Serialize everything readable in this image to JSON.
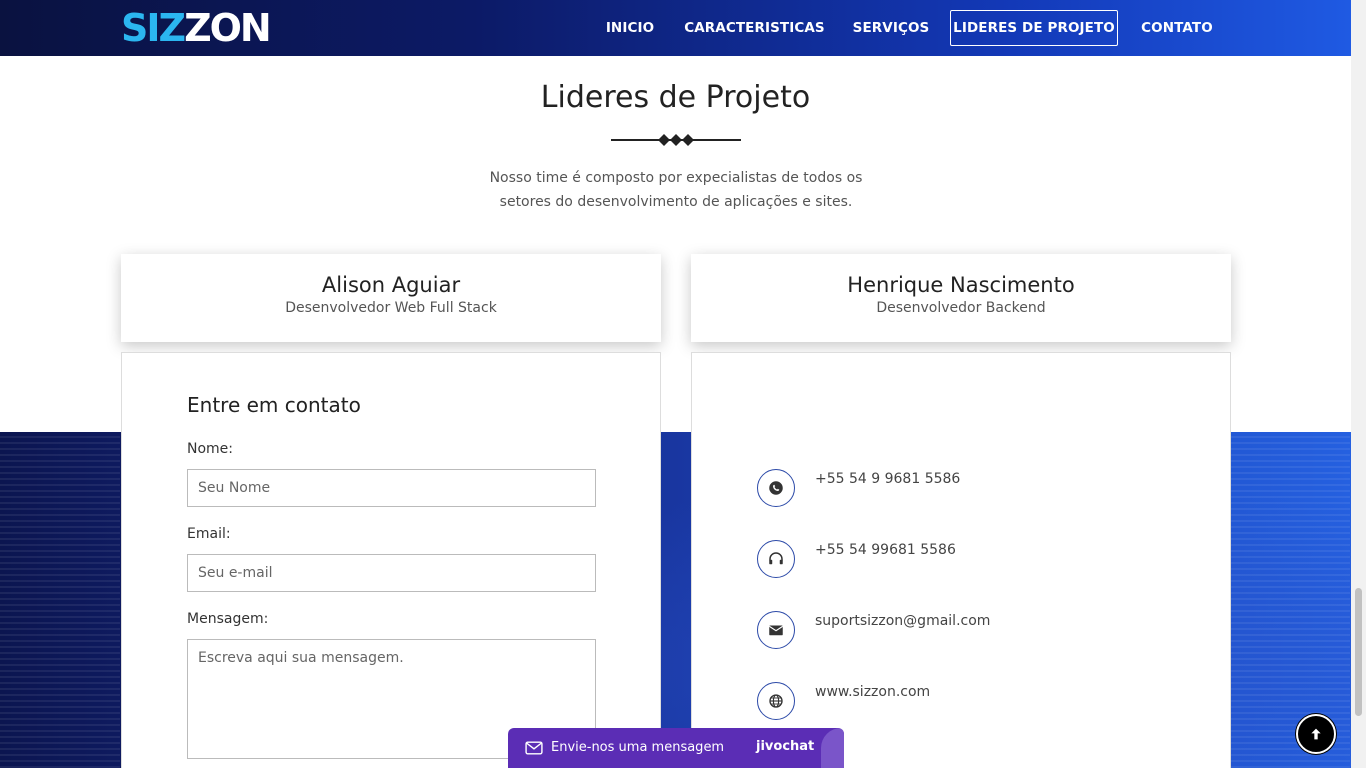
{
  "header": {
    "logo_part1": "SIZ",
    "logo_part2": "ZON",
    "nav": [
      {
        "label": "INICIO"
      },
      {
        "label": "CARACTERISTICAS"
      },
      {
        "label": "SERVIÇOS"
      },
      {
        "label": "LIDERES DE PROJETO",
        "active": true
      },
      {
        "label": "CONTATO"
      }
    ]
  },
  "section": {
    "title": "Lideres de Projeto",
    "subtitle": "Nosso time é composto por expecialistas de todos os setores do desenvolvimento de aplicações e sites."
  },
  "leaders": [
    {
      "name": "Alison Aguiar",
      "role": "Desenvolvedor Web Full Stack"
    },
    {
      "name": "Henrique Nascimento",
      "role": "Desenvolvedor Backend"
    }
  ],
  "contact_form": {
    "title": "Entre em contato",
    "name_label": "Nome:",
    "name_placeholder": "Seu Nome",
    "email_label": "Email:",
    "email_placeholder": "Seu e-mail",
    "message_label": "Mensagem:",
    "message_placeholder": "Escreva aqui sua mensagem."
  },
  "contact_info": {
    "whatsapp": "+55 54 9 9681 5586",
    "phone": "+55 54 99681 5586",
    "email": "suportsizzon@gmail.com",
    "website": "www.sizzon.com"
  },
  "chat": {
    "message": "Envie-nos uma mensagem",
    "brand": "jivochat"
  },
  "colors": {
    "nav_gradient_start": "#0a1240",
    "nav_gradient_end": "#1f5ae3",
    "logo_accent": "#2bb6f0",
    "chat_bg": "#5b2db5",
    "icon_border": "#2c4aa8"
  }
}
